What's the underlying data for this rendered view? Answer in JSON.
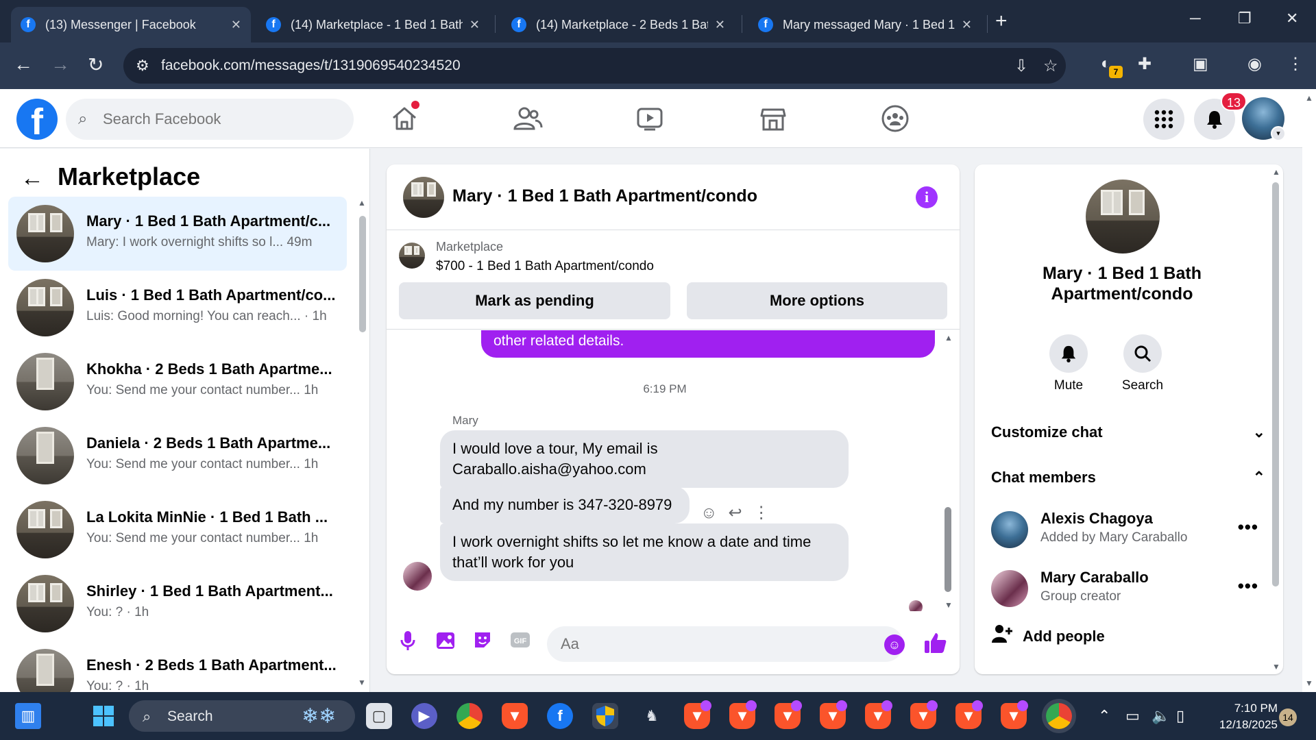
{
  "browser": {
    "tabs": [
      {
        "title": "(13) Messenger | Facebook",
        "active": true
      },
      {
        "title": "(14) Marketplace - 1 Bed 1 Bath",
        "active": false
      },
      {
        "title": "(14) Marketplace - 2 Beds 1 Bat",
        "active": false
      },
      {
        "title": "Mary messaged Mary · 1 Bed 1",
        "active": false
      }
    ],
    "url": "facebook.com/messages/t/1319069540234520",
    "extension_badge": "7"
  },
  "fb_nav": {
    "search_placeholder": "Search Facebook",
    "notifications_count": "13"
  },
  "left_panel": {
    "title": "Marketplace",
    "conversations": [
      {
        "name": "Mary · 1 Bed 1 Bath Apartment/c...",
        "preview": "Mary: I work overnight shifts so l...   49m",
        "selected": true
      },
      {
        "name": "Luis · 1 Bed 1 Bath Apartment/co...",
        "preview": "Luis: Good morning! You can reach... · 1h",
        "selected": false
      },
      {
        "name": "Khokha · 2 Beds 1 Bath Apartme...",
        "preview": "You: Send me your contact number...  1h",
        "selected": false
      },
      {
        "name": "Daniela · 2 Beds 1 Bath Apartme...",
        "preview": "You: Send me your contact number...  1h",
        "selected": false
      },
      {
        "name": "La Lokita MinNie · 1 Bed 1 Bath ...",
        "preview": "You: Send me your contact number...  1h",
        "selected": false
      },
      {
        "name": "Shirley · 1 Bed 1 Bath Apartment...",
        "preview": "You: ? · 1h",
        "selected": false
      },
      {
        "name": "Enesh · 2 Beds 1 Bath Apartment...",
        "preview": "You: ? · 1h",
        "selected": false
      }
    ]
  },
  "chat": {
    "title": "Mary · 1 Bed 1 Bath Apartment/condo",
    "listing": {
      "source": "Marketplace",
      "price_title": "$700 - 1 Bed 1 Bath Apartment/condo",
      "mark_pending": "Mark as pending",
      "more_options": "More options"
    },
    "outgoing_fragment": "other related details.",
    "timestamp": "6:19 PM",
    "sender_name": "Mary",
    "messages": [
      "I would love a tour, My email is Caraballo.aisha@yahoo.com",
      "And my number is 347-320-8979",
      "I work overnight shifts so let me know a date and time that’ll work for you"
    ],
    "composer_placeholder": "Aa",
    "accent_color": "#a020f0"
  },
  "info_panel": {
    "name": "Mary · 1 Bed 1 Bath Apartment/condo",
    "actions": [
      {
        "label": "Mute",
        "icon": "bell-icon"
      },
      {
        "label": "Search",
        "icon": "search-icon"
      }
    ],
    "customize_chat": "Customize chat",
    "chat_members": "Chat members",
    "members": [
      {
        "name": "Alexis Chagoya",
        "subtitle": "Added by Mary Caraballo"
      },
      {
        "name": "Mary Caraballo",
        "subtitle": "Group creator"
      }
    ],
    "add_people": "Add people"
  },
  "taskbar": {
    "search_label": "Search",
    "time": "7:10 PM",
    "date": "12/18/2025",
    "notification_count": "14"
  }
}
